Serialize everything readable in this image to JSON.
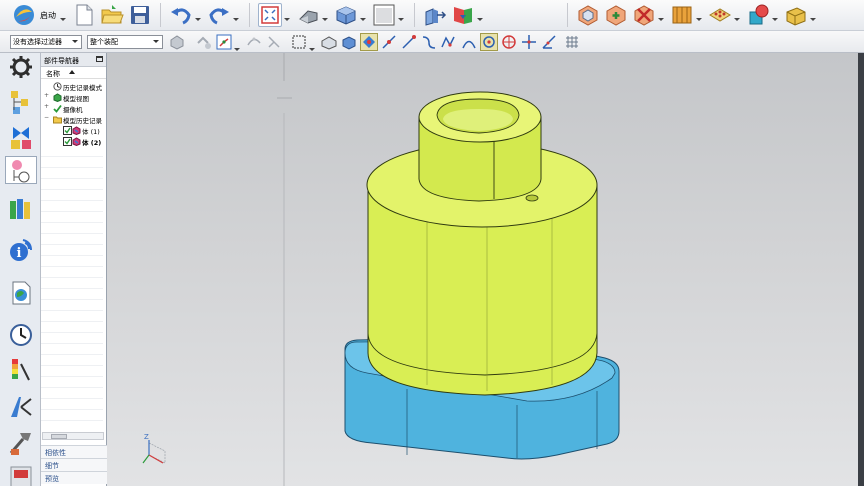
{
  "toolbar": {
    "start_label": "启动"
  },
  "selection_bar": {
    "filter_value": "没有选择过滤器",
    "scope_value": "整个装配"
  },
  "navigator": {
    "title": "部件导航器",
    "column_name": "名称",
    "items": [
      {
        "label": "历史记录模式"
      },
      {
        "label": "模型视图"
      },
      {
        "label": "摄像机"
      },
      {
        "label": "模型历史记录"
      },
      {
        "label": "体 (1)"
      },
      {
        "label": "体 (2)"
      }
    ],
    "sections": {
      "dependencies": "相依性",
      "details": "细节",
      "preview": "预览"
    }
  },
  "colors": {
    "body_yellow": "#d9ee54",
    "body_blue": "#4fb3de",
    "accent": "#2a4f8a"
  },
  "viewport": {
    "triad_axis_label": "Z"
  }
}
